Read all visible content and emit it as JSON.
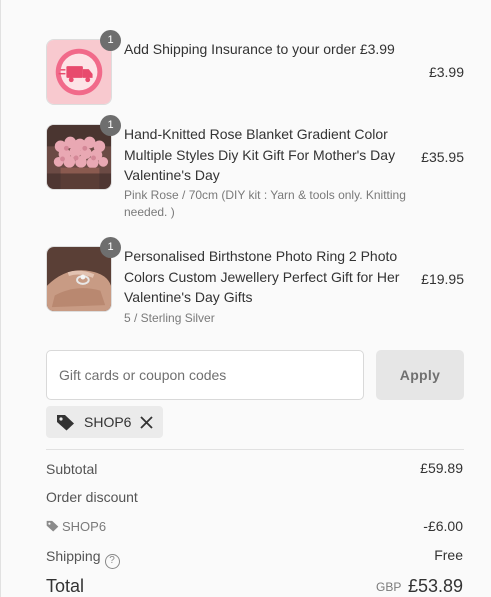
{
  "items": [
    {
      "quantity": "1",
      "title": "Add Shipping Insurance to your order £3.99",
      "variant": "",
      "price": "£3.99",
      "thumb_icon": "shipping-insurance-icon"
    },
    {
      "quantity": "1",
      "title": "Hand-Knitted Rose Blanket Gradient Color Multiple Styles Diy Kit Gift For Mother's Day Valentine's Day",
      "variant": "Pink Rose / 70cm (DIY kit : Yarn & tools only. Knitting needed. )",
      "price": "£35.95",
      "thumb_icon": "rose-bouquet-image"
    },
    {
      "quantity": "1",
      "title": "Personalised Birthstone Photo Ring 2 Photo Colors Custom Jewellery Perfect Gift for Her Valentine's Day Gifts",
      "variant": "5 / Sterling Silver",
      "price": "£19.95",
      "thumb_icon": "ring-on-hand-image"
    }
  ],
  "coupon": {
    "placeholder": "Gift cards or coupon codes",
    "value": "",
    "apply_label": "Apply"
  },
  "applied_code": {
    "label": "SHOP6"
  },
  "summary": {
    "subtotal_label": "Subtotal",
    "subtotal_value": "£59.89",
    "discount_label": "Order discount",
    "discount_code": "SHOP6",
    "discount_value": "-£6.00",
    "shipping_label": "Shipping",
    "shipping_info": "?",
    "shipping_value": "Free",
    "total_label": "Total",
    "total_currency": "GBP",
    "total_value": "£53.89"
  },
  "colors": {
    "background": "#fafafa",
    "badge": "#6e6e6e",
    "apply_button": "#e6e6e6",
    "chip": "#ebebeb"
  }
}
